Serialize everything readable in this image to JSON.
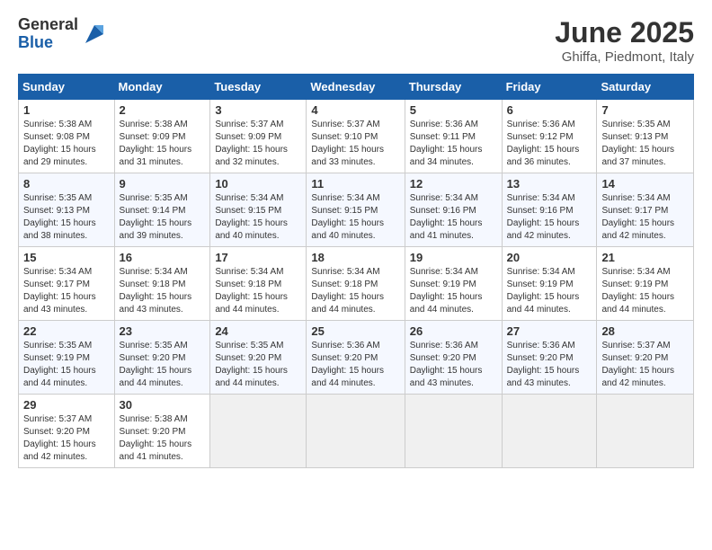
{
  "logo": {
    "general": "General",
    "blue": "Blue"
  },
  "header": {
    "title": "June 2025",
    "location": "Ghiffa, Piedmont, Italy"
  },
  "weekdays": [
    "Sunday",
    "Monday",
    "Tuesday",
    "Wednesday",
    "Thursday",
    "Friday",
    "Saturday"
  ],
  "weeks": [
    [
      {
        "day": "1",
        "info": "Sunrise: 5:38 AM\nSunset: 9:08 PM\nDaylight: 15 hours\nand 29 minutes."
      },
      {
        "day": "2",
        "info": "Sunrise: 5:38 AM\nSunset: 9:09 PM\nDaylight: 15 hours\nand 31 minutes."
      },
      {
        "day": "3",
        "info": "Sunrise: 5:37 AM\nSunset: 9:09 PM\nDaylight: 15 hours\nand 32 minutes."
      },
      {
        "day": "4",
        "info": "Sunrise: 5:37 AM\nSunset: 9:10 PM\nDaylight: 15 hours\nand 33 minutes."
      },
      {
        "day": "5",
        "info": "Sunrise: 5:36 AM\nSunset: 9:11 PM\nDaylight: 15 hours\nand 34 minutes."
      },
      {
        "day": "6",
        "info": "Sunrise: 5:36 AM\nSunset: 9:12 PM\nDaylight: 15 hours\nand 36 minutes."
      },
      {
        "day": "7",
        "info": "Sunrise: 5:35 AM\nSunset: 9:13 PM\nDaylight: 15 hours\nand 37 minutes."
      }
    ],
    [
      {
        "day": "8",
        "info": "Sunrise: 5:35 AM\nSunset: 9:13 PM\nDaylight: 15 hours\nand 38 minutes."
      },
      {
        "day": "9",
        "info": "Sunrise: 5:35 AM\nSunset: 9:14 PM\nDaylight: 15 hours\nand 39 minutes."
      },
      {
        "day": "10",
        "info": "Sunrise: 5:34 AM\nSunset: 9:15 PM\nDaylight: 15 hours\nand 40 minutes."
      },
      {
        "day": "11",
        "info": "Sunrise: 5:34 AM\nSunset: 9:15 PM\nDaylight: 15 hours\nand 40 minutes."
      },
      {
        "day": "12",
        "info": "Sunrise: 5:34 AM\nSunset: 9:16 PM\nDaylight: 15 hours\nand 41 minutes."
      },
      {
        "day": "13",
        "info": "Sunrise: 5:34 AM\nSunset: 9:16 PM\nDaylight: 15 hours\nand 42 minutes."
      },
      {
        "day": "14",
        "info": "Sunrise: 5:34 AM\nSunset: 9:17 PM\nDaylight: 15 hours\nand 42 minutes."
      }
    ],
    [
      {
        "day": "15",
        "info": "Sunrise: 5:34 AM\nSunset: 9:17 PM\nDaylight: 15 hours\nand 43 minutes."
      },
      {
        "day": "16",
        "info": "Sunrise: 5:34 AM\nSunset: 9:18 PM\nDaylight: 15 hours\nand 43 minutes."
      },
      {
        "day": "17",
        "info": "Sunrise: 5:34 AM\nSunset: 9:18 PM\nDaylight: 15 hours\nand 44 minutes."
      },
      {
        "day": "18",
        "info": "Sunrise: 5:34 AM\nSunset: 9:18 PM\nDaylight: 15 hours\nand 44 minutes."
      },
      {
        "day": "19",
        "info": "Sunrise: 5:34 AM\nSunset: 9:19 PM\nDaylight: 15 hours\nand 44 minutes."
      },
      {
        "day": "20",
        "info": "Sunrise: 5:34 AM\nSunset: 9:19 PM\nDaylight: 15 hours\nand 44 minutes."
      },
      {
        "day": "21",
        "info": "Sunrise: 5:34 AM\nSunset: 9:19 PM\nDaylight: 15 hours\nand 44 minutes."
      }
    ],
    [
      {
        "day": "22",
        "info": "Sunrise: 5:35 AM\nSunset: 9:19 PM\nDaylight: 15 hours\nand 44 minutes."
      },
      {
        "day": "23",
        "info": "Sunrise: 5:35 AM\nSunset: 9:20 PM\nDaylight: 15 hours\nand 44 minutes."
      },
      {
        "day": "24",
        "info": "Sunrise: 5:35 AM\nSunset: 9:20 PM\nDaylight: 15 hours\nand 44 minutes."
      },
      {
        "day": "25",
        "info": "Sunrise: 5:36 AM\nSunset: 9:20 PM\nDaylight: 15 hours\nand 44 minutes."
      },
      {
        "day": "26",
        "info": "Sunrise: 5:36 AM\nSunset: 9:20 PM\nDaylight: 15 hours\nand 43 minutes."
      },
      {
        "day": "27",
        "info": "Sunrise: 5:36 AM\nSunset: 9:20 PM\nDaylight: 15 hours\nand 43 minutes."
      },
      {
        "day": "28",
        "info": "Sunrise: 5:37 AM\nSunset: 9:20 PM\nDaylight: 15 hours\nand 42 minutes."
      }
    ],
    [
      {
        "day": "29",
        "info": "Sunrise: 5:37 AM\nSunset: 9:20 PM\nDaylight: 15 hours\nand 42 minutes."
      },
      {
        "day": "30",
        "info": "Sunrise: 5:38 AM\nSunset: 9:20 PM\nDaylight: 15 hours\nand 41 minutes."
      },
      {
        "day": "",
        "info": ""
      },
      {
        "day": "",
        "info": ""
      },
      {
        "day": "",
        "info": ""
      },
      {
        "day": "",
        "info": ""
      },
      {
        "day": "",
        "info": ""
      }
    ]
  ]
}
